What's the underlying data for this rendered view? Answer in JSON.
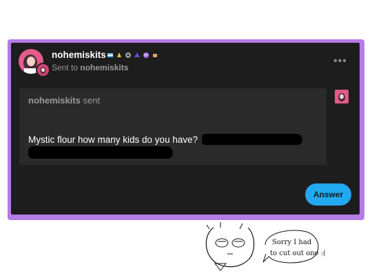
{
  "post": {
    "username": "nohemiskits",
    "sent_to_prefix": "Sent to",
    "sent_to_user": "nohemiskits",
    "more_label": "•••"
  },
  "ask": {
    "sender": "nohemiskits",
    "sent_word": "sent",
    "question": "Mystic flour how many kids do you have?"
  },
  "actions": {
    "answer_label": "Answer"
  },
  "doodle": {
    "note_line1": "Sorry I had",
    "note_line2": "to cut out one :("
  },
  "colors": {
    "frame": "#b57be6",
    "card": "#1d1d1d",
    "answer_button": "#23a9ef"
  },
  "icons": [
    "badge-icons",
    "more-options-icon",
    "avatar"
  ]
}
